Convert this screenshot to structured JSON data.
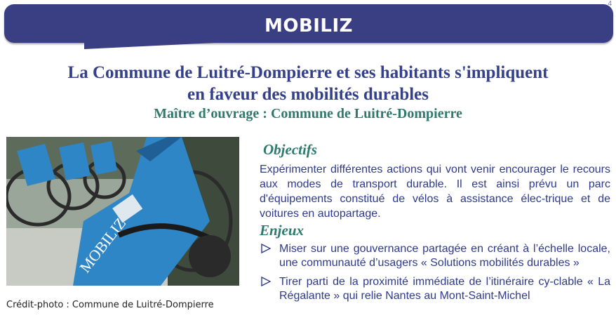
{
  "page_number": "4",
  "banner": {
    "title": "MOBILIZ"
  },
  "header": {
    "title_line1": "La Commune de Luitré-Dompierre et ses habitants s'impliquent",
    "title_line2": "en faveur des mobilités durables",
    "subtitle": "Maître d’ouvrage : Commune de Luitré-Dompierre"
  },
  "photo": {
    "bike_label": "MOBILIZ",
    "credit": "Crédit-photo :  Commune de Luitré-Dompierre"
  },
  "objectifs": {
    "heading": "Objectifs",
    "text": "Expérimenter différentes actions qui vont venir encourager le recours aux modes de transport durable. Il est ainsi prévu un parc d'équipements constitué de vélos à assistance élec-trique et de voitures en autopartage."
  },
  "enjeux": {
    "heading": "Enjeux",
    "items": [
      "Miser sur une gouvernance partagée en créant à l’échelle locale, une communauté d’usagers « Solutions mobilités durables »",
      "Tirer parti de la proximité immédiate de l’itinéraire cy-clable « La Régalante » qui relie Nantes au Mont-Saint-Michel"
    ]
  },
  "colors": {
    "banner": "#3a3f84",
    "title": "#34408a",
    "accent_green": "#2f7a6f",
    "body_text": "#2e3a8c"
  }
}
